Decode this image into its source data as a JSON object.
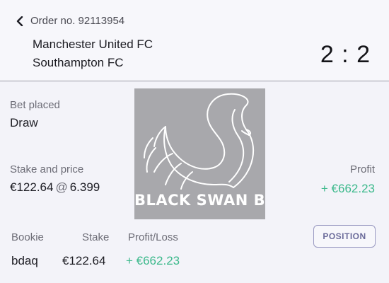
{
  "header": {
    "order_no": "Order no. 92113954",
    "home_team": "Manchester United FC",
    "away_team": "Southampton FC",
    "score": "2 : 2"
  },
  "bet": {
    "placed_label": "Bet placed",
    "placed_value": "Draw",
    "stake_price_label": "Stake and price",
    "stake": "€122.64",
    "at_symbol": "@",
    "price": "6.399",
    "profit_label": "Profit",
    "profit_value": "+ €662.23"
  },
  "table": {
    "headers": [
      "Bookie",
      "Stake",
      "Profit/Loss"
    ],
    "rows": [
      [
        "bdaq",
        "€122.64",
        "+ €662.23"
      ]
    ]
  },
  "position_button": "POSITION",
  "watermark": {
    "text_main": "BLACK SWAN BET",
    "text_accent": "$"
  },
  "colors": {
    "profit_green": "#3cb98c",
    "button_border": "#9a9ac2",
    "watermark_bg": "#a8a8ac",
    "watermark_gold": "#e3cb84"
  }
}
